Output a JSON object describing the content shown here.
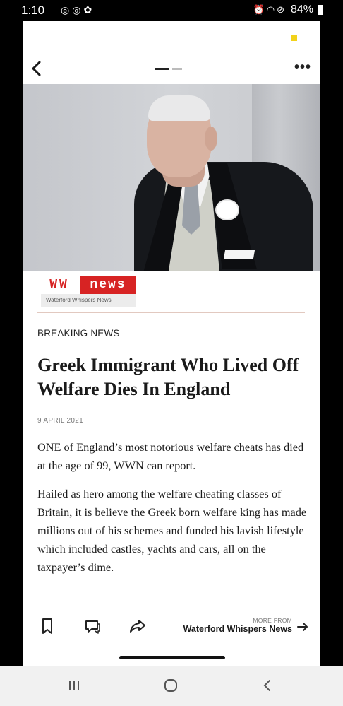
{
  "status_bar": {
    "time": "1:10",
    "left_icons": [
      "whatsapp-icon",
      "whatsapp-icon",
      "notification-icon"
    ],
    "battery": "84%"
  },
  "hero_image": {
    "alt": "elderly man in suit with white flower"
  },
  "brand": {
    "ww": "WW",
    "news": "news",
    "subtitle": "Waterford Whispers News",
    "accent": "#d72323"
  },
  "article": {
    "kicker": "BREAKING NEWS",
    "headline": "Greek Immigrant Who Lived Off Welfare Dies In England",
    "date": "9 APRIL 2021",
    "paragraphs": [
      "ONE of England’s most notorious welfare cheats has died at the age of 99, WWN can report.",
      "Hailed as hero among the welfare cheating classes of Britain, it is believe the Greek born welfare king has made millions out of his schemes and funded his lavish lifestyle which included castles, yachts and cars, all on the taxpayer’s dime."
    ]
  },
  "action_bar": {
    "more_from_label": "MORE FROM",
    "more_from_source": "Waterford Whispers News"
  }
}
